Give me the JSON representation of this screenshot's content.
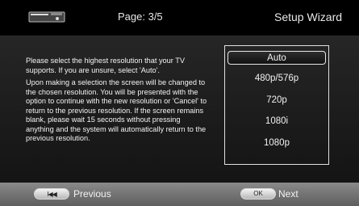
{
  "header": {
    "device_icon": "device-box-icon",
    "page": "Page: 3/5",
    "title": "Setup Wizard"
  },
  "instructions": {
    "paragraph_1": "Please select the highest resolution that your TV supports. If you are unsure, select 'Auto'.",
    "paragraph_2": "Upon making a selection the screen will be changed to the chosen resolution. You will be presented with the option to continue with the new resolution or 'Cancel' to return to the previous resolution. If the screen remains blank, please wait 15 seconds without pressing anything and the system will automatically return to the previous resolution."
  },
  "resolutions": {
    "options": [
      "Auto",
      "480p/576p",
      "720p",
      "1080i",
      "1080p"
    ],
    "selected": "Auto"
  },
  "footer": {
    "previous_label": "Previous",
    "previous_button_glyph": "I◀◀",
    "next_label": "Next",
    "ok_button_label": "OK"
  }
}
